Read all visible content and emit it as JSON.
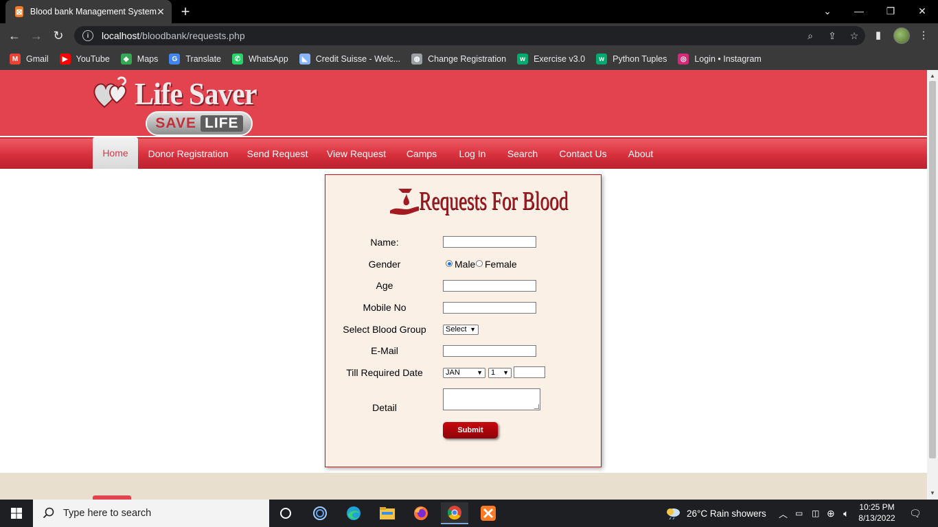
{
  "browser": {
    "tab_title": "Blood bank Management System",
    "tab_favicon": "xampp-icon",
    "url_host": "localhost",
    "url_path": "/bloodbank/requests.php",
    "bookmarks": [
      {
        "label": "Gmail",
        "icon": "gmail-icon",
        "color": "#ea4335"
      },
      {
        "label": "YouTube",
        "icon": "youtube-icon",
        "color": "#ff0000"
      },
      {
        "label": "Maps",
        "icon": "maps-icon",
        "color": "#34a853"
      },
      {
        "label": "Translate",
        "icon": "translate-icon",
        "color": "#4285f4"
      },
      {
        "label": "WhatsApp",
        "icon": "whatsapp-icon",
        "color": "#25d366"
      },
      {
        "label": "Credit Suisse - Welc...",
        "icon": "credit-suisse-icon",
        "color": "#8ab4f8"
      },
      {
        "label": "Change Registration",
        "icon": "globe-icon",
        "color": "#9aa0a6"
      },
      {
        "label": "Exercise v3.0",
        "icon": "w3schools-icon",
        "color": "#04aa6d"
      },
      {
        "label": "Python Tuples",
        "icon": "w3schools-icon",
        "color": "#04aa6d"
      },
      {
        "label": "Login • Instagram",
        "icon": "instagram-icon",
        "color": "#d62976"
      }
    ]
  },
  "site": {
    "logo_title": "Life Saver",
    "logo_badge_left": "SAVE",
    "logo_badge_right": "LIFE",
    "nav": [
      "Home",
      "Donor Registration",
      "Send Request",
      "View Request",
      "Camps",
      "Log In",
      "Search",
      "Contact Us",
      "About"
    ],
    "active_nav": "Home",
    "accent_color": "#e3424f"
  },
  "form": {
    "banner": "Requests For Blood",
    "name_label": "Name:",
    "gender_label": "Gender",
    "gender_male": "Male",
    "gender_female": "Female",
    "gender_selected": "Male",
    "age_label": "Age",
    "mobile_label": "Mobile No",
    "blood_group_label": "Select Blood Group",
    "blood_group_value": "Select",
    "email_label": "E-Mail",
    "date_label": "Till Required Date",
    "month_value": "JAN",
    "day_value": "1",
    "detail_label": "Detail",
    "submit_label": "Submit"
  },
  "taskbar": {
    "search_placeholder": "Type here to search",
    "weather": "26°C  Rain showers",
    "time": "10:25 PM",
    "date": "8/13/2022"
  }
}
